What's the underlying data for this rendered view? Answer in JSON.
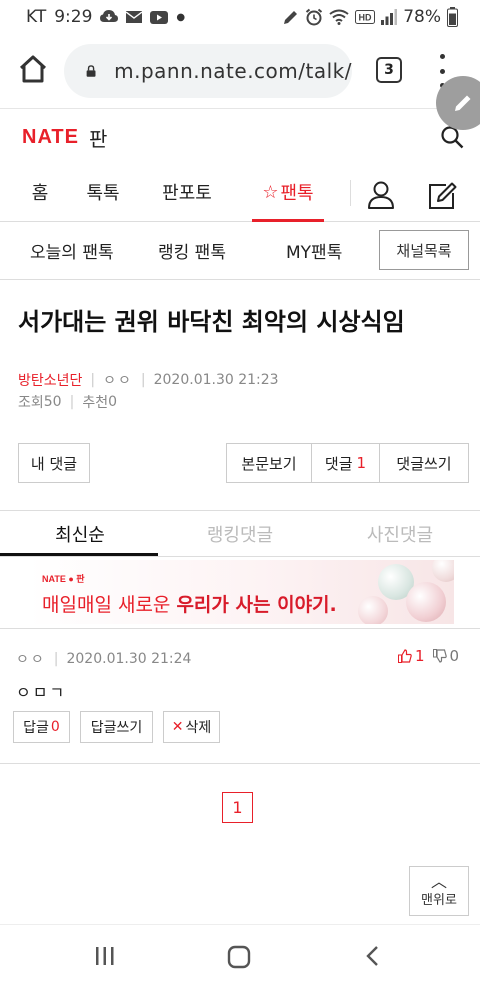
{
  "status_bar": {
    "carrier": "KT",
    "time": "9:29",
    "battery": "78%",
    "left_icons": [
      "cloud-download-icon",
      "mail-icon",
      "youtube-icon",
      "dot-icon"
    ],
    "right_icons": [
      "pen-icon",
      "alarm-icon",
      "wifi-icon",
      "hd-icon",
      "signal-icon",
      "battery-icon"
    ]
  },
  "browser": {
    "url": "m.pann.nate.com/talk/",
    "tab_count": "3"
  },
  "header": {
    "logo_brand": "NATE",
    "logo_service": "판"
  },
  "main_nav": {
    "items": [
      {
        "label": "홈"
      },
      {
        "label": "톡톡"
      },
      {
        "label": "판포토"
      },
      {
        "label": "팬톡"
      }
    ],
    "active_star": "☆"
  },
  "sub_nav": {
    "items": [
      {
        "label": "오늘의 팬톡"
      },
      {
        "label": "랭킹 팬톡"
      },
      {
        "label": "MY팬톡"
      }
    ],
    "channel_button": "채널목록"
  },
  "article": {
    "title": "서가대는 권위 바닥친 최악의 시상식임",
    "author": "방탄소년단",
    "nickname": "ㅇㅇ",
    "datetime": "2020.01.30 21:23",
    "views_label": "조회",
    "views": "50",
    "recommend_label": "추천",
    "recommend": "0"
  },
  "actions": {
    "my_comments": "내 댓글",
    "view_body": "본문보기",
    "comments_label": "댓글",
    "comments_count": "1",
    "write_comment": "댓글쓰기"
  },
  "comment_tabs": {
    "items": [
      {
        "label": "최신순"
      },
      {
        "label": "랭킹댓글"
      },
      {
        "label": "사진댓글"
      }
    ]
  },
  "banner": {
    "logo": "NATE ● 판",
    "text_normal": "매일매일 새로운 ",
    "text_strong": "우리가 사는 이야기."
  },
  "comment": {
    "nickname": "ㅇㅇ",
    "datetime": "2020.01.30 21:24",
    "body": "ㅇㅁㄱ",
    "up_votes": "1",
    "down_votes": "0",
    "reply_label": "답글",
    "reply_count": "0",
    "write_reply": "답글쓰기",
    "delete_mark": "✕",
    "delete_label": "삭제"
  },
  "pagination": {
    "current": "1"
  },
  "top_button": {
    "arrow": "︿",
    "label": "맨위로"
  },
  "colors": {
    "accent": "#e8202a",
    "text": "#222222",
    "muted": "#888888",
    "border": "#cccccc"
  }
}
